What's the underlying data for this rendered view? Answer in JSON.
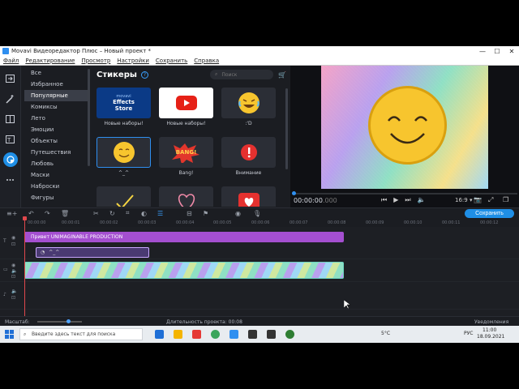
{
  "app": {
    "title": "Movavi Видеоредактор Плюс – Новый проект *",
    "window_controls": [
      "—",
      "☐",
      "✕"
    ]
  },
  "menu": [
    "Файл",
    "Редактирование",
    "Просмотр",
    "Настройки",
    "Сохранить",
    "Справка"
  ],
  "categories": {
    "items": [
      "Все",
      "Избранное",
      "Популярные",
      "Комиксы",
      "Лето",
      "Эмоции",
      "Объекты",
      "Путешествия",
      "Любовь",
      "Маски",
      "Наброски",
      "Фигуры"
    ],
    "selected": "Популярные"
  },
  "stickers": {
    "title": "Стикеры",
    "help": "?",
    "search_placeholder": "Поиск",
    "items": [
      {
        "caption": "Новые наборы!",
        "label": "movavi\nEffects\nStore"
      },
      {
        "caption": "Новые наборы!",
        "label": ""
      },
      {
        "caption": ":'D",
        "label": ""
      },
      {
        "caption": "^_^",
        "label": ""
      },
      {
        "caption": "Bang!",
        "label": "BANG!"
      },
      {
        "caption": "Внимание",
        "label": ""
      },
      {
        "caption": "",
        "label": ""
      },
      {
        "caption": "",
        "label": ""
      },
      {
        "caption": "",
        "label": ""
      }
    ]
  },
  "preview": {
    "timecode": "00:00:00",
    "timecode_ms": ".000",
    "aspect": "16:9 ▾"
  },
  "timeline": {
    "save_label": "Сохранить",
    "ruler": [
      "00:00:00",
      "00:00:01",
      "00:00:02",
      "00:00:03",
      "00:00:04",
      "00:00:05",
      "00:00:06",
      "00:00:07",
      "00:00:08",
      "00:00:09",
      "00:00:10",
      "00:00:11",
      "00:00:12"
    ],
    "title_clip": "Привет UNIMAGINABLE PRODUCTION",
    "sticker_clip": "^_^"
  },
  "status": {
    "scale_label": "Масштаб:",
    "duration_label": "Длительность проекта: 00:08",
    "notifications": "Уведомления"
  },
  "taskbar": {
    "search_placeholder": "Введите здесь текст для поиска",
    "temperature": "5°C",
    "lang": "РУС",
    "time": "11:00",
    "date": "18.09.2021"
  },
  "colors": {
    "accent": "#1f8fe6",
    "title_clip": "#a44fd0",
    "playhead": "#e0484c"
  }
}
